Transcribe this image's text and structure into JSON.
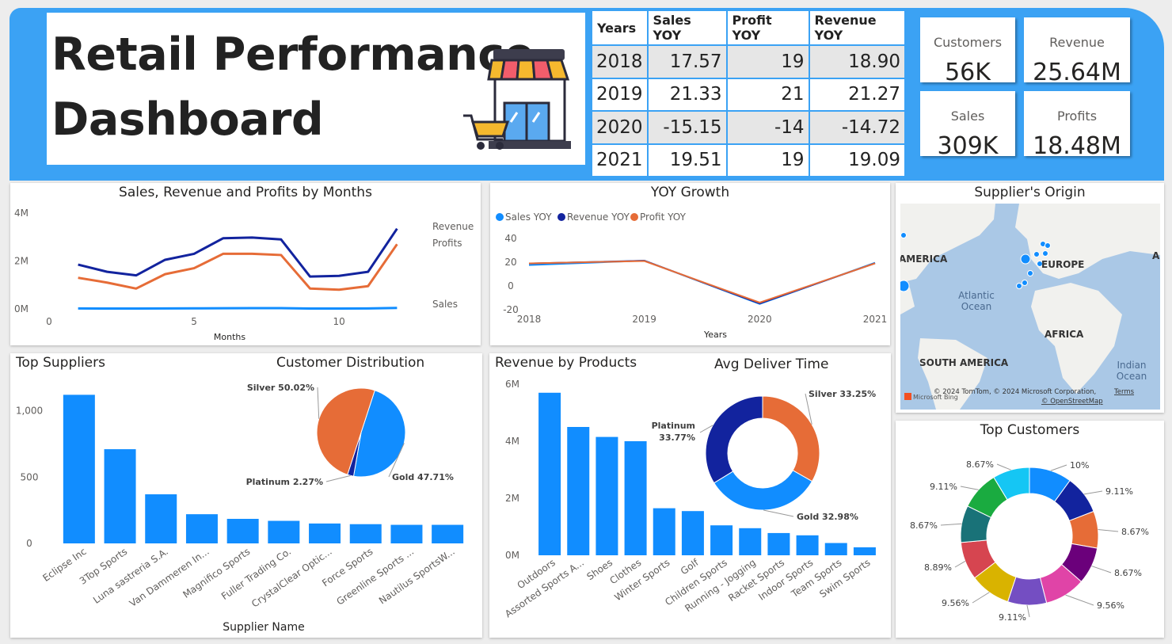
{
  "header": {
    "title_line1": "Retail Performance",
    "title_line2": "Dashboard",
    "icon": "storefront-icon"
  },
  "yoy_table": {
    "columns": [
      "Years",
      "Sales YOY",
      "Profit YOY",
      "Revenue YOY"
    ],
    "rows": [
      [
        "2018",
        "17.57",
        "19",
        "18.90"
      ],
      [
        "2019",
        "21.33",
        "21",
        "21.27"
      ],
      [
        "2020",
        "-15.15",
        "-14",
        "-14.72"
      ],
      [
        "2021",
        "19.51",
        "19",
        "19.09"
      ]
    ]
  },
  "kpis": [
    {
      "label": "Customers",
      "value": "56K"
    },
    {
      "label": "Revenue",
      "value": "25.64M"
    },
    {
      "label": "Sales",
      "value": "309K"
    },
    {
      "label": "Profits",
      "value": "18.48M"
    }
  ],
  "map": {
    "title": "Supplier's Origin",
    "labels": [
      "AMERICA",
      "EUROPE",
      "A",
      "Atlantic",
      "Ocean",
      "AFRICA",
      "SOUTH AMERICA",
      "Indian",
      "Ocean"
    ],
    "attribution": "© 2024 TomTom, © 2024 Microsoft Corporation,",
    "terms": "Terms",
    "osm": "© OpenStreetMap",
    "bing": "Microsoft Bing"
  },
  "colors": {
    "accent": "#3ba2f4",
    "bar": "#118dff",
    "sales": "#118dff",
    "revenue": "#12239e",
    "profit": "#e66c37"
  },
  "chart_data": [
    {
      "id": "monthly",
      "type": "line",
      "title": "Sales, Revenue and Profits by Months",
      "xlabel": "Months",
      "ylabel": "",
      "x": [
        1,
        2,
        3,
        4,
        5,
        6,
        7,
        8,
        9,
        10,
        11,
        12
      ],
      "xlim": [
        0,
        13
      ],
      "xticks": [
        "0",
        "5",
        "10"
      ],
      "xtick_values": [
        0,
        5,
        10
      ],
      "ylim": [
        0,
        4000000
      ],
      "yticks": [
        "0M",
        "2M",
        "4M"
      ],
      "ytick_values": [
        0,
        2000000,
        4000000
      ],
      "grid": false,
      "series": [
        {
          "name": "Revenue",
          "color": "#12239e",
          "values": [
            1850000,
            1550000,
            1400000,
            2050000,
            2300000,
            2950000,
            2980000,
            2900000,
            1350000,
            1380000,
            1550000,
            3350000
          ]
        },
        {
          "name": "Profits",
          "color": "#e66c37",
          "values": [
            1300000,
            1100000,
            850000,
            1450000,
            1700000,
            2300000,
            2300000,
            2250000,
            850000,
            800000,
            950000,
            2700000
          ]
        },
        {
          "name": "Sales",
          "color": "#118dff",
          "values": [
            20000,
            18000,
            17000,
            22000,
            25000,
            30000,
            32000,
            31000,
            18000,
            18000,
            20000,
            40000
          ]
        }
      ]
    },
    {
      "id": "yoy",
      "type": "line",
      "title": "YOY Growth",
      "xlabel": "Years",
      "ylabel": "",
      "categories": [
        "2018",
        "2019",
        "2020",
        "2021"
      ],
      "ylim": [
        -20,
        40
      ],
      "yticks": [
        "-20",
        "0",
        "20",
        "40"
      ],
      "ytick_values": [
        -20,
        0,
        20,
        40
      ],
      "legend_position": "top-left",
      "grid": false,
      "series": [
        {
          "name": "Sales YOY",
          "color": "#118dff",
          "values": [
            17.57,
            21.33,
            -15.15,
            19.51
          ]
        },
        {
          "name": "Revenue YOY",
          "color": "#12239e",
          "values": [
            18.9,
            21.27,
            -14.72,
            19.09
          ]
        },
        {
          "name": "Profit YOY",
          "color": "#e66c37",
          "values": [
            19,
            21,
            -14,
            19
          ]
        }
      ]
    },
    {
      "id": "suppliers",
      "type": "bar",
      "title": "Top Suppliers",
      "xlabel": "Supplier Name",
      "ylabel": "",
      "categories": [
        "Eclipse Inc",
        "3Top Sports",
        "Luna sastreria S.A.",
        "Van Dammeren In...",
        "Magnifico Sports",
        "Fuller Trading Co.",
        "CrystalClear Optic...",
        "Force Sports",
        "Greenline Sports ...",
        "Nautilus SportsW..."
      ],
      "values": [
        1120,
        710,
        370,
        220,
        185,
        170,
        150,
        145,
        140,
        140
      ],
      "ylim": [
        0,
        1200
      ],
      "yticks": [
        "0",
        "500",
        "1,000"
      ],
      "ytick_values": [
        0,
        500,
        1000
      ],
      "color": "#118dff",
      "grid": false
    },
    {
      "id": "customer_dist",
      "type": "pie",
      "title": "Customer Distribution",
      "slices": [
        {
          "name": "Gold",
          "value": 47.71,
          "label": "Gold 47.71%",
          "color": "#118dff"
        },
        {
          "name": "Platinum",
          "value": 2.27,
          "label": "Platinum 2.27%",
          "color": "#12239e"
        },
        {
          "name": "Silver",
          "value": 50.02,
          "label": "Silver 50.02%",
          "color": "#e66c37"
        }
      ]
    },
    {
      "id": "products",
      "type": "bar",
      "title": "Revenue by Products",
      "xlabel": "",
      "ylabel": "",
      "categories": [
        "Outdoors",
        "Assorted Sports A...",
        "Shoes",
        "Clothes",
        "Winter Sports",
        "Golf",
        "Children Sports",
        "Running - Jogging",
        "Racket Sports",
        "Indoor Sports",
        "Team Sports",
        "Swim Sports"
      ],
      "values": [
        5700000,
        4500000,
        4150000,
        4000000,
        1650000,
        1550000,
        1050000,
        950000,
        780000,
        700000,
        430000,
        280000
      ],
      "ylim": [
        0,
        6000000
      ],
      "yticks": [
        "0M",
        "2M",
        "4M",
        "6M"
      ],
      "ytick_values": [
        0,
        2000000,
        4000000,
        6000000
      ],
      "color": "#118dff",
      "grid": false
    },
    {
      "id": "delivery",
      "type": "pie",
      "title": "Avg Deliver Time",
      "donut": true,
      "slices": [
        {
          "name": "Silver",
          "value": 33.25,
          "label": "Silver 33.25%",
          "color": "#e66c37"
        },
        {
          "name": "Gold",
          "value": 32.98,
          "label": "Gold 32.98%",
          "color": "#118dff"
        },
        {
          "name": "Platinum",
          "value": 33.77,
          "label": "Platinum 33.77%",
          "color": "#12239e"
        }
      ]
    },
    {
      "id": "top_customers",
      "type": "pie",
      "title": "Top Customers",
      "donut": true,
      "slices": [
        {
          "value": 10,
          "label": "10%",
          "color": "#118dff"
        },
        {
          "value": 9.11,
          "label": "9.11%",
          "color": "#12239e"
        },
        {
          "value": 8.67,
          "label": "8.67%",
          "color": "#e66c37"
        },
        {
          "value": 8.67,
          "label": "8.67%",
          "color": "#6b007b"
        },
        {
          "value": 9.56,
          "label": "9.56%",
          "color": "#e044a7"
        },
        {
          "value": 9.11,
          "label": "9.11%",
          "color": "#744ec2"
        },
        {
          "value": 9.56,
          "label": "9.56%",
          "color": "#d9b300"
        },
        {
          "value": 8.89,
          "label": "8.89%",
          "color": "#d64550"
        },
        {
          "value": 8.67,
          "label": "8.67%",
          "color": "#197278"
        },
        {
          "value": 9.11,
          "label": "9.11%",
          "color": "#1aab40"
        },
        {
          "value": 8.67,
          "label": "8.67%",
          "color": "#15c6f4"
        }
      ]
    }
  ]
}
